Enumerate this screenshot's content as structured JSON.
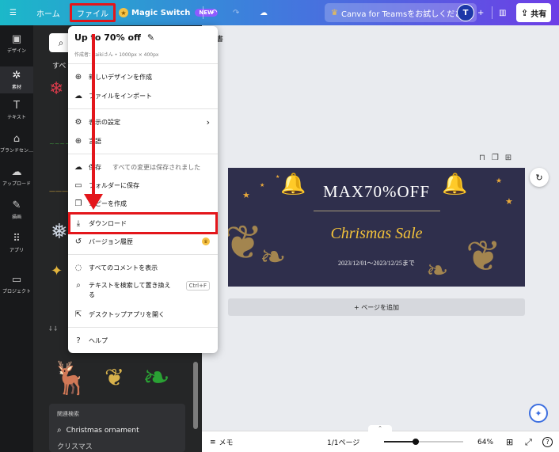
{
  "topbar": {
    "menu_icon": "hamburger-icon",
    "home": "ホーム",
    "file": "ファイル",
    "magic_switch": "Magic Switch",
    "magic_badge": "NEW",
    "teams": "Canva for Teamsをお試しください",
    "avatar": "T",
    "share": "共有"
  },
  "leftnav": {
    "items": [
      {
        "label": "デザイン",
        "icon": "layout-icon"
      },
      {
        "label": "素材",
        "icon": "elements-icon"
      },
      {
        "label": "テキスト",
        "icon": "text-icon"
      },
      {
        "label": "ブランドセン…",
        "icon": "brand-icon"
      },
      {
        "label": "アップロード",
        "icon": "upload-icon"
      },
      {
        "label": "描画",
        "icon": "draw-icon"
      },
      {
        "label": "アプリ",
        "icon": "apps-icon"
      },
      {
        "label": "プロジェクト",
        "icon": "folder-icon"
      }
    ]
  },
  "panel": {
    "heading": "すべ",
    "related_title": "関連検索",
    "related_items": [
      "Christmas ornament",
      "クリスマス"
    ]
  },
  "file_menu": {
    "title": "Up to 70% off",
    "meta": "作成者：taikiさん • 1000px × 400px",
    "items": {
      "new_design": "新しいデザインを作成",
      "import": "ファイルをインポート",
      "view_settings": "表示の設定",
      "language": "言語",
      "save": "保存",
      "save_note": "すべての変更は保存されました",
      "save_to_folder": "フォルダーに保存",
      "copy": "コピーを作成",
      "download": "ダウンロード",
      "version_history": "バージョン履歴",
      "show_comments": "すべてのコメントを表示",
      "find_replace": "テキストを検索して置き換える",
      "find_shortcut": "Ctrl+F",
      "desktop_app": "デスクトップアプリを開く",
      "help": "ヘルプ"
    }
  },
  "canvas": {
    "top_label": "書",
    "banner_title": "MAX70%OFF",
    "banner_subtitle": "Chrismas Sale",
    "banner_date": "2023/12/01〜2023/12/25まで",
    "add_page": "+ ページを追加"
  },
  "bottombar": {
    "memo": "メモ",
    "pages": "1/1ページ",
    "zoom": "64%",
    "help": "?"
  },
  "colors": {
    "highlight": "#e3161b",
    "nav_bg": "#18191b",
    "panel_bg": "#252627",
    "banner_bg": "#2f2f4c",
    "banner_accent": "#f3c23a"
  }
}
